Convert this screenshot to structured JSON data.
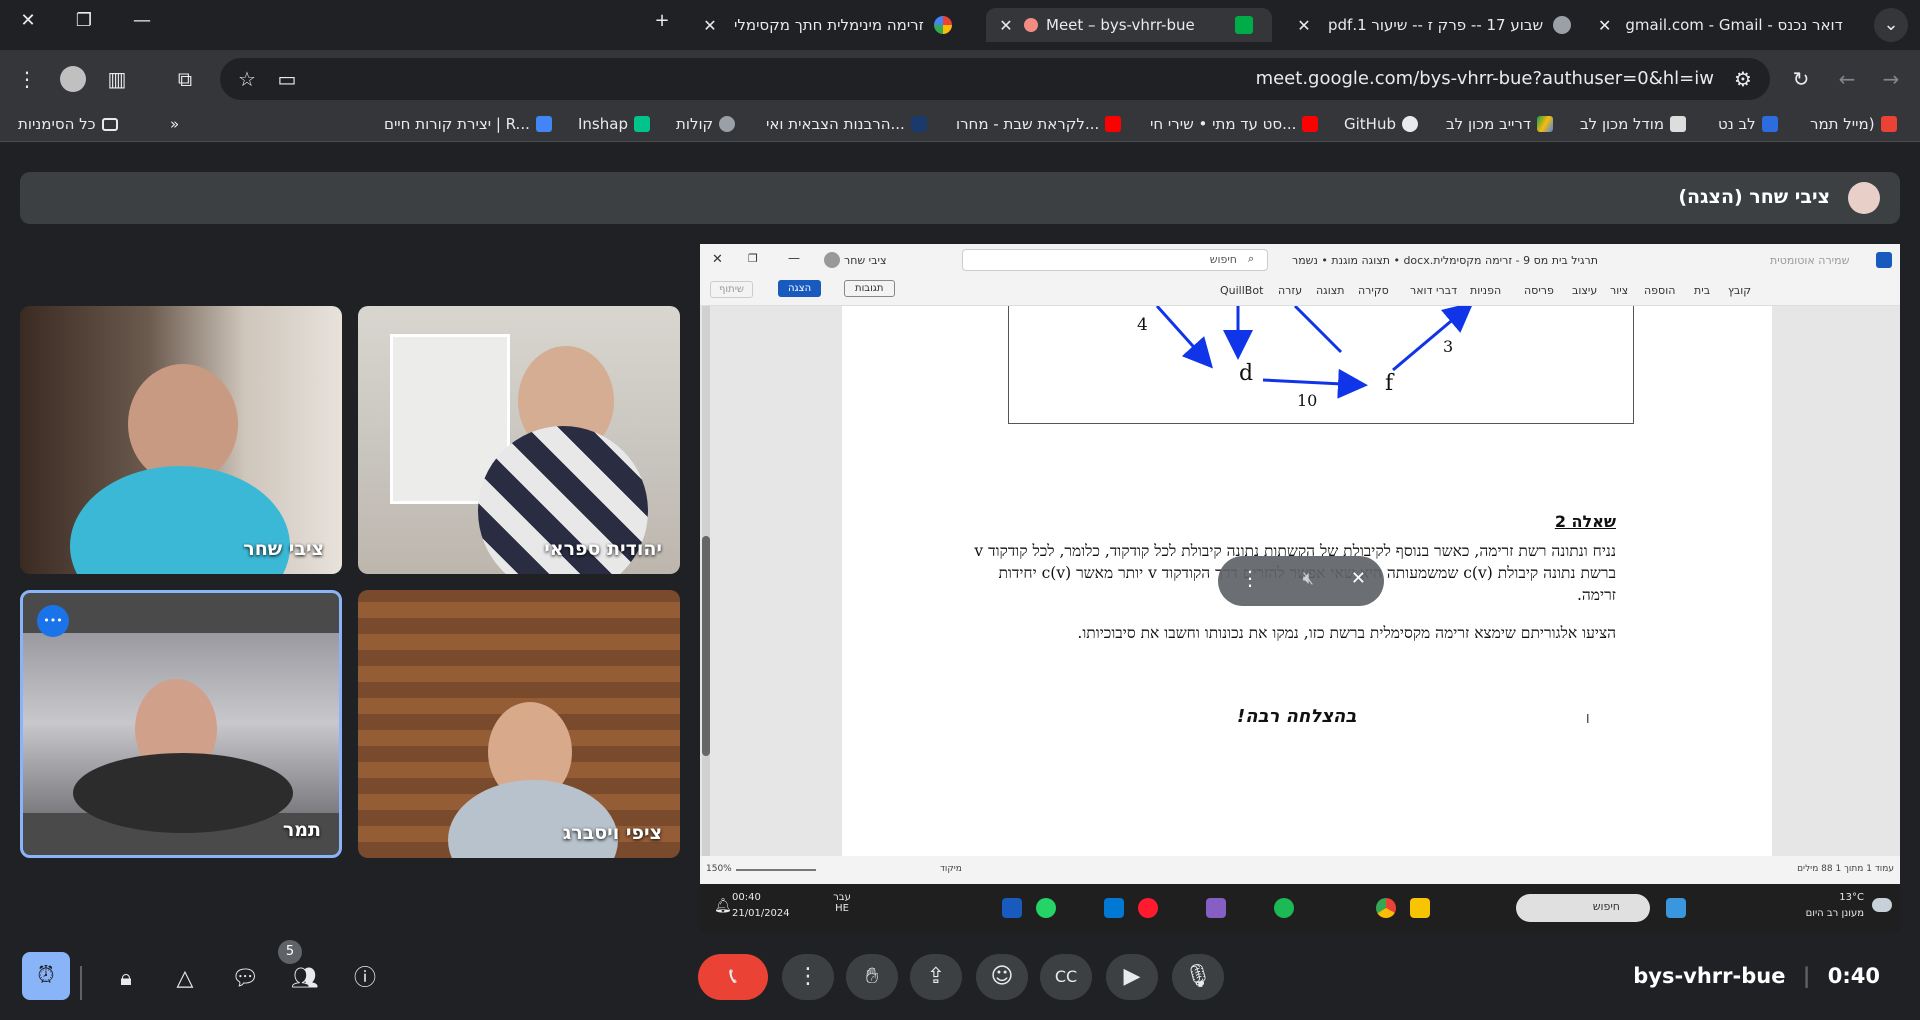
{
  "browser": {
    "tabs": [
      {
        "title": "דואר נכנס - gmail.com - Gmail",
        "badge": "0"
      },
      {
        "title": "שבוע 17 -- פרק ז -- שיעור 1.pdf"
      },
      {
        "title": "Meet – bys-vhrr-bue"
      },
      {
        "title": "זרימה מינימלית חתך מקסימלי"
      }
    ],
    "new_tab": "+",
    "url": "meet.google.com/bys-vhrr-bue?authuser=0&hl=iw",
    "bookmarks": [
      "מייל תמר)",
      "לב נט",
      "מודל מכון לב",
      "דרייב מכון לב",
      "GitHub",
      "סט עד מתי • שירי חי...",
      "לקראת שבת - מחרו...",
      "הרבנות הצבאית ואי...",
      "קולות",
      "Inshap",
      "יצירת קורות חיים | R...",
      "כל הסימניות"
    ],
    "bookmark_more": "»"
  },
  "meet": {
    "presenter_label": "ציבי שחר (הצגה)",
    "participants": [
      "ציבי שחר",
      "יהודית ספראי",
      "תמר",
      "ציפי ויסברג"
    ],
    "more_options": "•••",
    "meeting_code": "bys-vhrr-bue",
    "time": "0:40",
    "people_count": "5"
  },
  "word": {
    "doc_title": "תרגיל בית מס 9 - זרימה מקסימלית.docx • תצוגה מוגנת • נשמר",
    "autosave": "שמירה אוטומטית",
    "search_placeholder": "חיפוש",
    "user": "ציבי שחר",
    "ribbon_tabs": [
      "קובץ",
      "בית",
      "הוספה",
      "ציור",
      "עיצוב",
      "פריסה",
      "הפניות",
      "דברי דואר",
      "סקירה",
      "תצוגה",
      "עזרה",
      "QuillBot"
    ],
    "comments_btn": "תגובות",
    "present_btn": "הצגה",
    "share_btn": "שיתוף",
    "graph": {
      "labels": [
        "4",
        "d",
        "10",
        "f",
        "3"
      ]
    },
    "question_title": "שאלה 2",
    "question_text": "נניח ונתונה רשת זרימה, כאשר בנוסף לקיבולת של הקשתות נתונה קיבולת לכל קודקוד, כלומר, לכל קודקוד  v ברשת נתונה קיבולת c(v) שמשמעותה היא שאי אפשר להזרים דרך הקודקוד v יותר מאשר c(v) יחידות זרימה.",
    "question_text2": "הציעו אלגוריתם שימצא זרימה מקסימלית ברשת כזו, נמקו את נכונותו וחשבו את סיבוכיותו.",
    "good_luck": "בהצלחה רבה!",
    "status_left": "עמוד 1 מתוך 1  88 מילים",
    "status_focus": "מיקוד",
    "zoom": "150%"
  },
  "taskbar": {
    "search": "חיפוש",
    "time": "00:40",
    "date": "21/01/2024",
    "lang": "עבר HE",
    "weather_temp": "13°C",
    "weather_desc": "מעונן רב היום",
    "notif": "1"
  },
  "colors": {
    "accent": "#8ab4f8",
    "end_call": "#ea4335",
    "active_tile_border": "#8ab4f8",
    "ms_blue": "#185abd"
  }
}
